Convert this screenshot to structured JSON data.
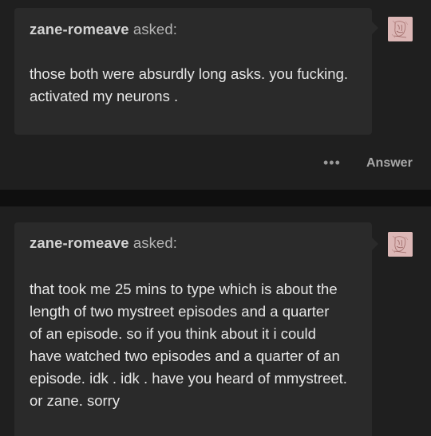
{
  "posts": [
    {
      "asker": "zane-romeave",
      "asked_label": "asked:",
      "text_lines": [
        "those both were absurdly long asks. you fucking.",
        "activated my neurons ."
      ],
      "avatar_icon": "pink-sketch-avatar-icon",
      "more_label": "•••",
      "answer_label": "Answer"
    },
    {
      "asker": "zane-romeave",
      "asked_label": "asked:",
      "text_lines": [
        "that took me 25 mins to type which is about the",
        "length of two mystreet episodes and a quarter",
        "of an episode. so if you think about it i could",
        "have watched two episodes and a quarter of an",
        "episode. idk . idk . have you heard of mmystreet.",
        "or zane. sorry"
      ],
      "avatar_icon": "pink-sketch-avatar-icon"
    }
  ],
  "colors": {
    "page_background": "#0f0f0f",
    "post_background": "#1f1f1f",
    "bubble_background": "#2a2a2a",
    "avatar_background": "#d9b5b5"
  }
}
